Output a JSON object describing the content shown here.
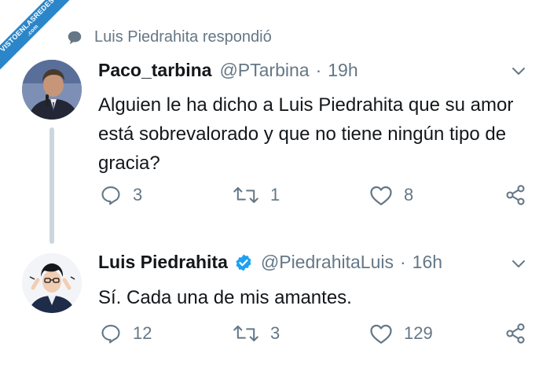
{
  "watermark": {
    "line1": "VISTOENLASREDES",
    "line2": ".com"
  },
  "replied_label": "Luis Piedrahita respondió",
  "tweets": [
    {
      "name": "Paco_tarbina",
      "handle": "@PTarbina",
      "separator": "·",
      "time": "19h",
      "verified": false,
      "text": "Alguien le ha dicho a Luis Piedrahita que su amor está sobrevalorado y que no tiene ningún tipo de gracia?",
      "replies": "3",
      "retweets": "1",
      "likes": "8"
    },
    {
      "name": "Luis Piedrahita",
      "handle": "@PiedrahitaLuis",
      "separator": "·",
      "time": "16h",
      "verified": true,
      "text": "Sí. Cada una de mis amantes.",
      "replies": "12",
      "retweets": "3",
      "likes": "129"
    }
  ],
  "colors": {
    "muted": "#657786",
    "verified": "#1da1f2",
    "thread_line": "#ccd6dd",
    "watermark": "#2a86c9"
  },
  "icons": [
    "reply-icon",
    "retweet-icon",
    "like-icon",
    "share-icon",
    "chevron-down-icon",
    "verified-badge-icon",
    "speech-bubble-icon"
  ]
}
